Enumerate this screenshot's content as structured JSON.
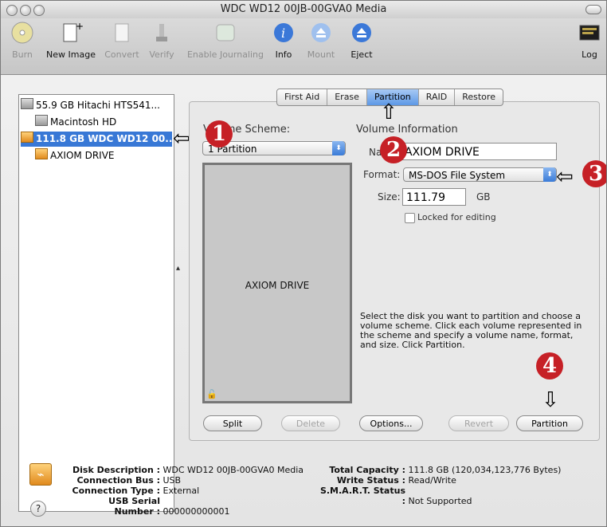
{
  "window": {
    "title": "WDC WD12 00JB-00GVA0 Media"
  },
  "toolbar": {
    "buttons": [
      {
        "label": "Burn",
        "icon": "burn-icon"
      },
      {
        "label": "New Image",
        "icon": "new-image-icon"
      },
      {
        "label": "Convert",
        "icon": "convert-icon"
      },
      {
        "label": "Verify",
        "icon": "verify-icon"
      },
      {
        "label": "Enable Journaling",
        "icon": "journaling-icon"
      },
      {
        "label": "Info",
        "icon": "info-icon"
      },
      {
        "label": "Mount",
        "icon": "mount-icon"
      },
      {
        "label": "Eject",
        "icon": "eject-icon"
      },
      {
        "label": "Log",
        "icon": "log-icon"
      }
    ]
  },
  "sidebar": {
    "items": [
      {
        "label": "55.9 GB Hitachi HTS541..."
      },
      {
        "label": "Macintosh HD"
      },
      {
        "label": "111.8 GB WDC WD12 00..."
      },
      {
        "label": "AXIOM DRIVE"
      }
    ]
  },
  "tabs": [
    "First Aid",
    "Erase",
    "Partition",
    "RAID",
    "Restore"
  ],
  "partition": {
    "volume_scheme_label": "Volume Scheme:",
    "scheme_value": "1 Partition",
    "volume_info_heading": "Volume Information",
    "name_label": "Name:",
    "name_value": "AXIOM DRIVE",
    "format_label": "Format:",
    "format_value": "MS-DOS File System",
    "size_label": "Size:",
    "size_value": "111.79",
    "size_unit": "GB",
    "locked_label": "Locked for editing",
    "scheme_volume_label": "AXIOM DRIVE",
    "help_text": "Select the disk you want to partition and choose a volume scheme. Click each volume represented in the scheme and specify a volume name, format, and size. Click Partition.",
    "buttons": {
      "split": "Split",
      "delete": "Delete",
      "options": "Options...",
      "revert": "Revert",
      "partition": "Partition"
    }
  },
  "annotations": {
    "badge1": "1",
    "badge2": "2",
    "badge3": "3",
    "badge4": "4"
  },
  "info": {
    "disk_description_key": "Disk Description :",
    "disk_description": "WDC WD12 00JB-00GVA0 Media",
    "connection_bus_key": "Connection Bus :",
    "connection_bus": "USB",
    "connection_type_key": "Connection Type :",
    "connection_type": "External",
    "usb_serial_key": "USB Serial Number :",
    "usb_serial": "000000000001",
    "total_capacity_key": "Total Capacity :",
    "total_capacity": "111.8 GB (120,034,123,776 Bytes)",
    "write_status_key": "Write Status :",
    "write_status": "Read/Write",
    "smart_key": "S.M.A.R.T. Status :",
    "smart_status": "Not Supported"
  },
  "colors": {
    "selection": "#3878d6",
    "badge": "#c62026"
  }
}
